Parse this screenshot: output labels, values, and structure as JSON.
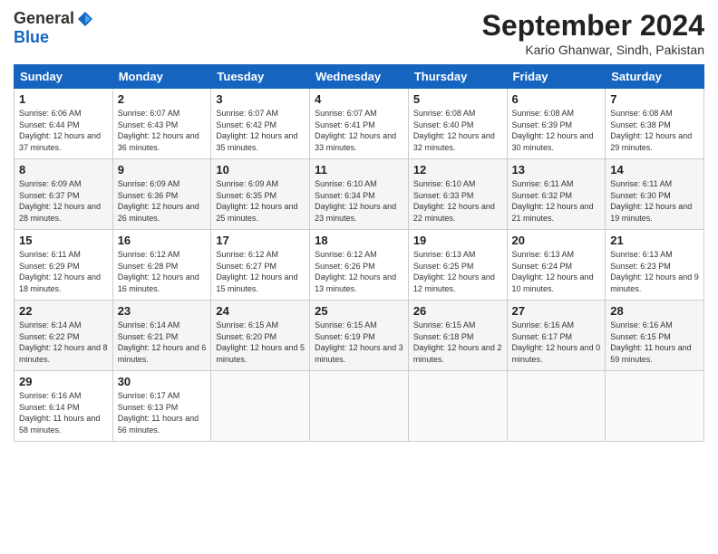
{
  "logo": {
    "general": "General",
    "blue": "Blue"
  },
  "title": "September 2024",
  "location": "Kario Ghanwar, Sindh, Pakistan",
  "days_of_week": [
    "Sunday",
    "Monday",
    "Tuesday",
    "Wednesday",
    "Thursday",
    "Friday",
    "Saturday"
  ],
  "weeks": [
    [
      {
        "day": "1",
        "sunrise": "6:06 AM",
        "sunset": "6:44 PM",
        "daylight": "12 hours and 37 minutes."
      },
      {
        "day": "2",
        "sunrise": "6:07 AM",
        "sunset": "6:43 PM",
        "daylight": "12 hours and 36 minutes."
      },
      {
        "day": "3",
        "sunrise": "6:07 AM",
        "sunset": "6:42 PM",
        "daylight": "12 hours and 35 minutes."
      },
      {
        "day": "4",
        "sunrise": "6:07 AM",
        "sunset": "6:41 PM",
        "daylight": "12 hours and 33 minutes."
      },
      {
        "day": "5",
        "sunrise": "6:08 AM",
        "sunset": "6:40 PM",
        "daylight": "12 hours and 32 minutes."
      },
      {
        "day": "6",
        "sunrise": "6:08 AM",
        "sunset": "6:39 PM",
        "daylight": "12 hours and 30 minutes."
      },
      {
        "day": "7",
        "sunrise": "6:08 AM",
        "sunset": "6:38 PM",
        "daylight": "12 hours and 29 minutes."
      }
    ],
    [
      {
        "day": "8",
        "sunrise": "6:09 AM",
        "sunset": "6:37 PM",
        "daylight": "12 hours and 28 minutes."
      },
      {
        "day": "9",
        "sunrise": "6:09 AM",
        "sunset": "6:36 PM",
        "daylight": "12 hours and 26 minutes."
      },
      {
        "day": "10",
        "sunrise": "6:09 AM",
        "sunset": "6:35 PM",
        "daylight": "12 hours and 25 minutes."
      },
      {
        "day": "11",
        "sunrise": "6:10 AM",
        "sunset": "6:34 PM",
        "daylight": "12 hours and 23 minutes."
      },
      {
        "day": "12",
        "sunrise": "6:10 AM",
        "sunset": "6:33 PM",
        "daylight": "12 hours and 22 minutes."
      },
      {
        "day": "13",
        "sunrise": "6:11 AM",
        "sunset": "6:32 PM",
        "daylight": "12 hours and 21 minutes."
      },
      {
        "day": "14",
        "sunrise": "6:11 AM",
        "sunset": "6:30 PM",
        "daylight": "12 hours and 19 minutes."
      }
    ],
    [
      {
        "day": "15",
        "sunrise": "6:11 AM",
        "sunset": "6:29 PM",
        "daylight": "12 hours and 18 minutes."
      },
      {
        "day": "16",
        "sunrise": "6:12 AM",
        "sunset": "6:28 PM",
        "daylight": "12 hours and 16 minutes."
      },
      {
        "day": "17",
        "sunrise": "6:12 AM",
        "sunset": "6:27 PM",
        "daylight": "12 hours and 15 minutes."
      },
      {
        "day": "18",
        "sunrise": "6:12 AM",
        "sunset": "6:26 PM",
        "daylight": "12 hours and 13 minutes."
      },
      {
        "day": "19",
        "sunrise": "6:13 AM",
        "sunset": "6:25 PM",
        "daylight": "12 hours and 12 minutes."
      },
      {
        "day": "20",
        "sunrise": "6:13 AM",
        "sunset": "6:24 PM",
        "daylight": "12 hours and 10 minutes."
      },
      {
        "day": "21",
        "sunrise": "6:13 AM",
        "sunset": "6:23 PM",
        "daylight": "12 hours and 9 minutes."
      }
    ],
    [
      {
        "day": "22",
        "sunrise": "6:14 AM",
        "sunset": "6:22 PM",
        "daylight": "12 hours and 8 minutes."
      },
      {
        "day": "23",
        "sunrise": "6:14 AM",
        "sunset": "6:21 PM",
        "daylight": "12 hours and 6 minutes."
      },
      {
        "day": "24",
        "sunrise": "6:15 AM",
        "sunset": "6:20 PM",
        "daylight": "12 hours and 5 minutes."
      },
      {
        "day": "25",
        "sunrise": "6:15 AM",
        "sunset": "6:19 PM",
        "daylight": "12 hours and 3 minutes."
      },
      {
        "day": "26",
        "sunrise": "6:15 AM",
        "sunset": "6:18 PM",
        "daylight": "12 hours and 2 minutes."
      },
      {
        "day": "27",
        "sunrise": "6:16 AM",
        "sunset": "6:17 PM",
        "daylight": "12 hours and 0 minutes."
      },
      {
        "day": "28",
        "sunrise": "6:16 AM",
        "sunset": "6:15 PM",
        "daylight": "11 hours and 59 minutes."
      }
    ],
    [
      {
        "day": "29",
        "sunrise": "6:16 AM",
        "sunset": "6:14 PM",
        "daylight": "11 hours and 58 minutes."
      },
      {
        "day": "30",
        "sunrise": "6:17 AM",
        "sunset": "6:13 PM",
        "daylight": "11 hours and 56 minutes."
      },
      null,
      null,
      null,
      null,
      null
    ]
  ]
}
